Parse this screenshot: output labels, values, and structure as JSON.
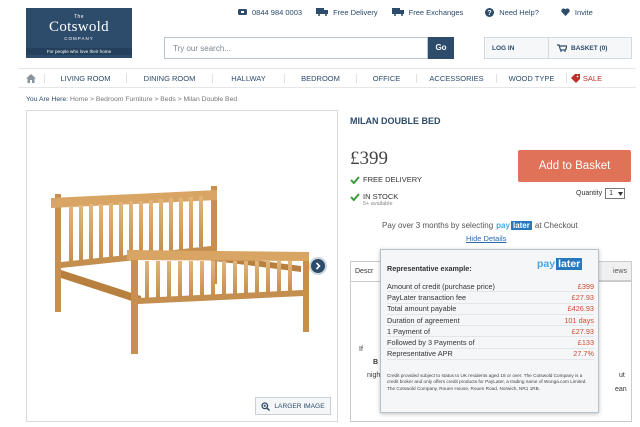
{
  "utility": {
    "phone": "0844 984 0003",
    "free_delivery": "Free Delivery",
    "free_exchanges": "Free Exchanges",
    "need_help": "Need Help?",
    "invite": "Invite"
  },
  "logo": {
    "the": "The",
    "name": "Cotswold",
    "company": "COMPANY",
    "tagline": "For people who love their home"
  },
  "search": {
    "placeholder": "Try our search...",
    "button": "Go"
  },
  "account": {
    "login": "LOG IN",
    "basket": "BASKET (0)"
  },
  "nav": {
    "items": [
      "LIVING ROOM",
      "DINING ROOM",
      "HALLWAY",
      "BEDROOM",
      "OFFICE",
      "ACCESSORIES",
      "WOOD TYPE"
    ],
    "sale": "SALE"
  },
  "breadcrumb": {
    "label": "You Are Here:",
    "path": "Home > Bedroom Furniture > Beds > Milan Double Bed"
  },
  "product": {
    "title": "MILAN DOUBLE BED",
    "price": "£399",
    "free_delivery": "FREE DELIVERY",
    "in_stock": "IN STOCK",
    "available": "5+ available",
    "add_to_basket": "Add to Basket",
    "quantity_label": "Quantity",
    "quantity_value": "1",
    "larger_image": "LARGER IMAGE"
  },
  "paylater": {
    "pre": "Pay over 3 months by selecting",
    "post": "at Checkout",
    "pay": "pay",
    "later": "later",
    "hide_details": "Hide Details"
  },
  "tabs": {
    "first": "Descr",
    "last": "iews"
  },
  "tab_fragments": {
    "f1": "If",
    "f2": "B",
    "f3": "nigh",
    "f4": "ut",
    "f5": "ean"
  },
  "popup": {
    "heading": "Representative example:",
    "rows": [
      {
        "label": "Amount of credit (purchase price)",
        "value": "£399"
      },
      {
        "label": "PayLater transaction fee",
        "value": "£27.93"
      },
      {
        "label": "Total amount payable",
        "value": "£426.93"
      },
      {
        "label": "Duration of agreement",
        "value": "101 days"
      },
      {
        "label": "1 Payment of",
        "value": "£27.93"
      },
      {
        "label": "Followed by 3 Payments of",
        "value": "£133"
      },
      {
        "label": "Representative APR",
        "value": "27.7%"
      }
    ],
    "legal": "Credit provided subject to status to UK residents aged 18 or over. The Cotswold Company is a credit broker and only offers credit products for PayLater, a trading name of Wonga.com Limited. The Cotswold Company, Rouen House, Rouen Road, Norwich, NR1 1RB."
  },
  "colors": {
    "brand": "#2d4b6b",
    "cta": "#e07257",
    "stock_green": "#3a9a3a",
    "paylater_blue": "#2778bd",
    "sale_red": "#c0302a"
  }
}
